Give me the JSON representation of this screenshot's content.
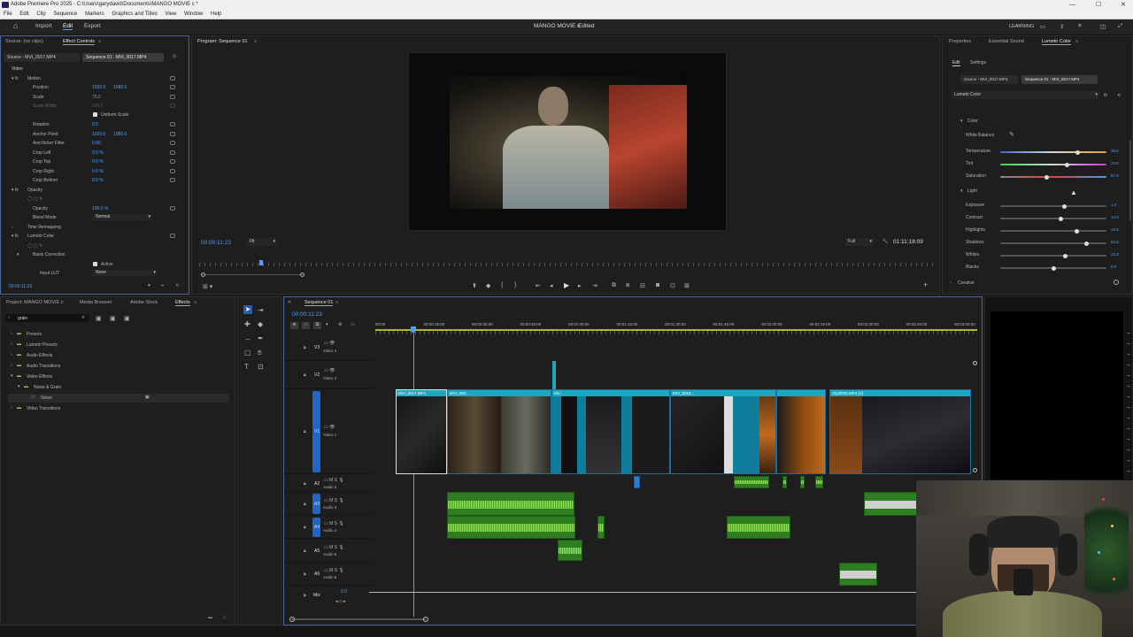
{
  "titlebar": {
    "title": "Adobe Premiere Pro 2025 - C:\\Users\\garydavid\\Documents\\MANGO MOVIE c *"
  },
  "menu": [
    "File",
    "Edit",
    "Clip",
    "Sequence",
    "Markers",
    "Graphics and Titles",
    "View",
    "Window",
    "Help"
  ],
  "workspace": {
    "home": "home-icon",
    "import": "Import",
    "edit": "Edit",
    "export": "Export",
    "project_title": "MANGO MOVIE c",
    "status": "Edited",
    "learning": "LEARNING"
  },
  "effect_controls": {
    "tabs": [
      "Source: (no clips)",
      "Effect Controls"
    ],
    "source_tab": "Source - MVI_0017.MP4",
    "seq_tab": "Sequence 01 - MVI_0017.MP4",
    "video_label": "Video",
    "motion": "Motion",
    "position": "Position",
    "pos_x": "1920.0",
    "pos_y": "1080.0",
    "scale": "Scale",
    "scale_val": "75.0",
    "scale_width": "Scale Width",
    "scale_width_val": "100.0",
    "uniform": "Uniform Scale",
    "rotation": "Rotation",
    "rotation_val": "0.0",
    "anchor": "Anchor Point",
    "anchor_x": "1920.0",
    "anchor_y": "1080.0",
    "antiflicker": "Anti-flicker Filter",
    "antiflicker_val": "0.00",
    "crop_left": "Crop Left",
    "crop_top": "Crop Top",
    "crop_right": "Crop Right",
    "crop_bottom": "Crop Bottom",
    "crop_val": "0.0 %",
    "opacity_group": "Opacity",
    "opacity": "Opacity",
    "opacity_val": "100.0 %",
    "blend": "Blend Mode",
    "blend_val": "Normal",
    "time_remap": "Time Remapping",
    "lumetri": "Lumetri Color",
    "basic": "Basic Correction",
    "active": "Active",
    "input_lut": "Input LUT",
    "input_lut_val": "None",
    "timecode": "00:00:11:23"
  },
  "program": {
    "tab": "Program: Sequence 01",
    "timecode": "00:00:11:23",
    "fit": "Fit",
    "full": "Full",
    "duration": "01:11:18:09"
  },
  "lumetri": {
    "tabs": [
      "Properties",
      "Essential Sound",
      "Lumetri Color"
    ],
    "subtabs": [
      "Edit",
      "Settings"
    ],
    "source_tab": "Source - MVI_0017.MP4",
    "seq_tab": "Sequence 01 - MVI_0017.MP4",
    "preset": "Lumetri Color",
    "color_section": "Color",
    "white_balance": "White Balance",
    "color_sliders": [
      {
        "label": "Temperature",
        "value": "35.5",
        "pos": 0.73
      },
      {
        "label": "Tint",
        "value": "24.0",
        "pos": 0.63
      },
      {
        "label": "Saturation",
        "value": "87.6",
        "pos": 0.44
      }
    ],
    "light_section": "Light",
    "light_sliders": [
      {
        "label": "Exposure",
        "value": "1.0",
        "pos": 0.6
      },
      {
        "label": "Contrast",
        "value": "14.0",
        "pos": 0.57
      },
      {
        "label": "Highlights",
        "value": "43.6",
        "pos": 0.72
      },
      {
        "label": "Shadows",
        "value": "62.8",
        "pos": 0.81
      },
      {
        "label": "Whites",
        "value": "22.3",
        "pos": 0.61
      },
      {
        "label": "Blacks",
        "value": "0.0",
        "pos": 0.5
      }
    ],
    "creative": "Creative"
  },
  "project": {
    "tabs": [
      "Project: MANGO MOVIE c",
      "Media Browser",
      "Adobe Stock",
      "Effects"
    ],
    "search_value": "grain",
    "tree": [
      {
        "label": "Presets",
        "indent": 0
      },
      {
        "label": "Lumetri Presets",
        "indent": 0
      },
      {
        "label": "Audio Effects",
        "indent": 0
      },
      {
        "label": "Audio Transitions",
        "indent": 0
      },
      {
        "label": "Video Effects",
        "indent": 0
      },
      {
        "label": "Noise & Grain",
        "indent": 1
      },
      {
        "label": "Noise",
        "indent": 2
      },
      {
        "label": "Video Transitions",
        "indent": 0
      }
    ]
  },
  "timeline": {
    "tab": "Sequence 01",
    "timecode": "00:00:11:23",
    "ruler": [
      "00:00",
      "00:00:15:00",
      "00:00:30:00",
      "00:00:45:00",
      "00:01:00:00",
      "00:01:15:00",
      "00:01:30:00",
      "00:01:45:00",
      "00:02:00:00",
      "00:02:15:00",
      "00:02:30:00",
      "00:02:45:00",
      "00:03:00:00"
    ],
    "tracks": {
      "v3": "V3",
      "v2": "V2",
      "v1": "V1",
      "a1": "A1",
      "a2": "A2",
      "a3": "A3",
      "a4": "A4",
      "a5": "A5",
      "a6": "A6",
      "mix": "Mix"
    },
    "track_names": {
      "v3": "Video 3",
      "v2": "Video 2",
      "v1": "Video 1",
      "a2": "Audio 2",
      "a3": "Audio 3",
      "a4": "Audio 4",
      "a5": "Audio 5",
      "a6": "Audio 6"
    },
    "mix_val": "0.0",
    "clips": [
      "MVI_0017.MP4",
      "MVI_000...",
      "MV...",
      "MVI_0016...",
      "Clip0005.MP4 [V]"
    ]
  }
}
